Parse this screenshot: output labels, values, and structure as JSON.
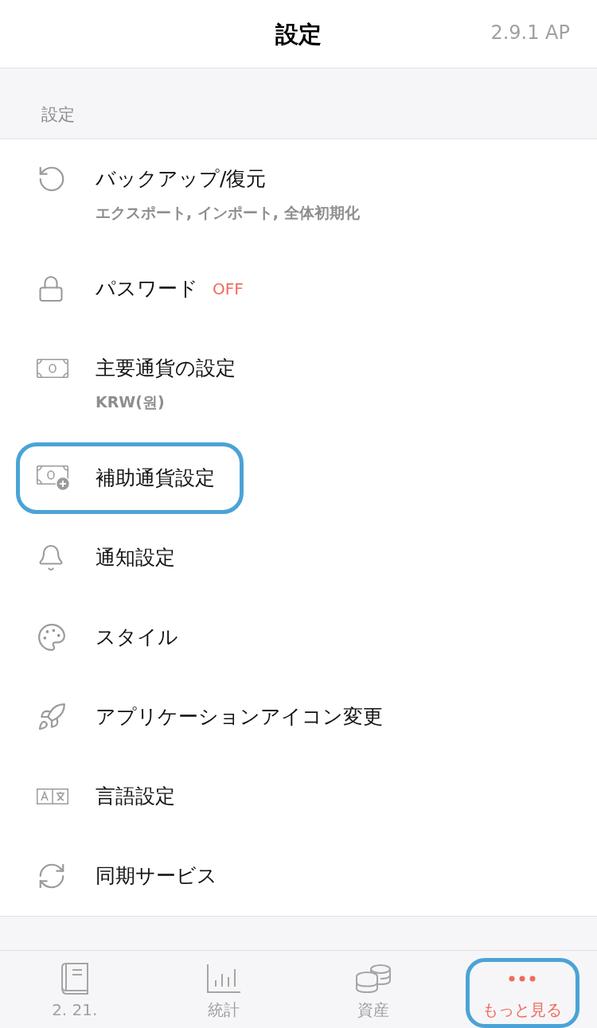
{
  "header": {
    "title": "設定",
    "version": "2.9.1 AP"
  },
  "section": {
    "label": "設定"
  },
  "settings_items": [
    {
      "kind": "restore",
      "title": "バックアップ/復元",
      "subtitle": "エクスポート, インポート, 全体初期化",
      "highlighted": false
    },
    {
      "kind": "lock",
      "title": "パスワード",
      "status": "OFF",
      "highlighted": false
    },
    {
      "kind": "banknote",
      "title": "主要通貨の設定",
      "subtitle": "KRW(원)",
      "highlighted": false
    },
    {
      "kind": "banknote-plus",
      "title": "補助通貨設定",
      "highlighted": true
    },
    {
      "kind": "bell",
      "title": "通知設定",
      "highlighted": false
    },
    {
      "kind": "palette",
      "title": "スタイル",
      "highlighted": false
    },
    {
      "kind": "rocket",
      "title": "アプリケーションアイコン変更",
      "highlighted": false
    },
    {
      "kind": "language",
      "title": "言語設定",
      "highlighted": false
    },
    {
      "kind": "sync",
      "title": "同期サービス",
      "highlighted": false
    }
  ],
  "tab_bar": [
    {
      "kind": "book",
      "label": "2. 21.",
      "selected": false,
      "highlighted": false
    },
    {
      "kind": "chart",
      "label": "統計",
      "selected": false,
      "highlighted": false
    },
    {
      "kind": "coins",
      "label": "資産",
      "selected": false,
      "highlighted": false
    },
    {
      "kind": "more",
      "label": "もっと見る",
      "selected": true,
      "highlighted": true
    }
  ]
}
